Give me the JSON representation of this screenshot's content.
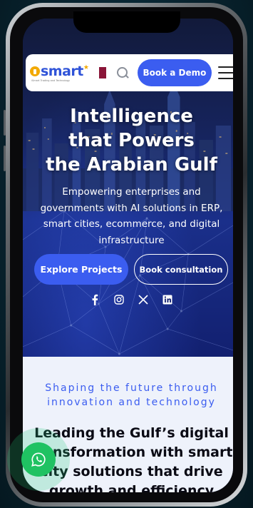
{
  "header": {
    "logo_text": "smart",
    "logo_subtitle": "iSmart Trading and Technology",
    "book_demo_label": "Book a Demo"
  },
  "hero": {
    "title_lines": [
      "Intelligence",
      "that Powers",
      "the Arabian Gulf"
    ],
    "subtitle_lines": [
      "Empowering enterprises and",
      "governments with AI solutions in ERP,",
      "smart cities, ecommerce, and digital",
      "infrastructure"
    ],
    "explore_label": "Explore Projects",
    "consult_label": "Book consultation"
  },
  "socials": [
    "facebook-icon",
    "instagram-icon",
    "x-icon",
    "linkedin-icon"
  ],
  "section": {
    "tagline_lines": [
      "Shaping the future through",
      "innovation and technology"
    ],
    "heading_lines": [
      "Leading the Gulf’s digital",
      "transformation with smart",
      "city solutions that drive",
      "growth and efficiency"
    ]
  },
  "colors": {
    "accent": "#3b5df0",
    "logo_orange": "#f2a900",
    "whatsapp_green": "#1fc262",
    "qatar_maroon": "#8a1538"
  }
}
